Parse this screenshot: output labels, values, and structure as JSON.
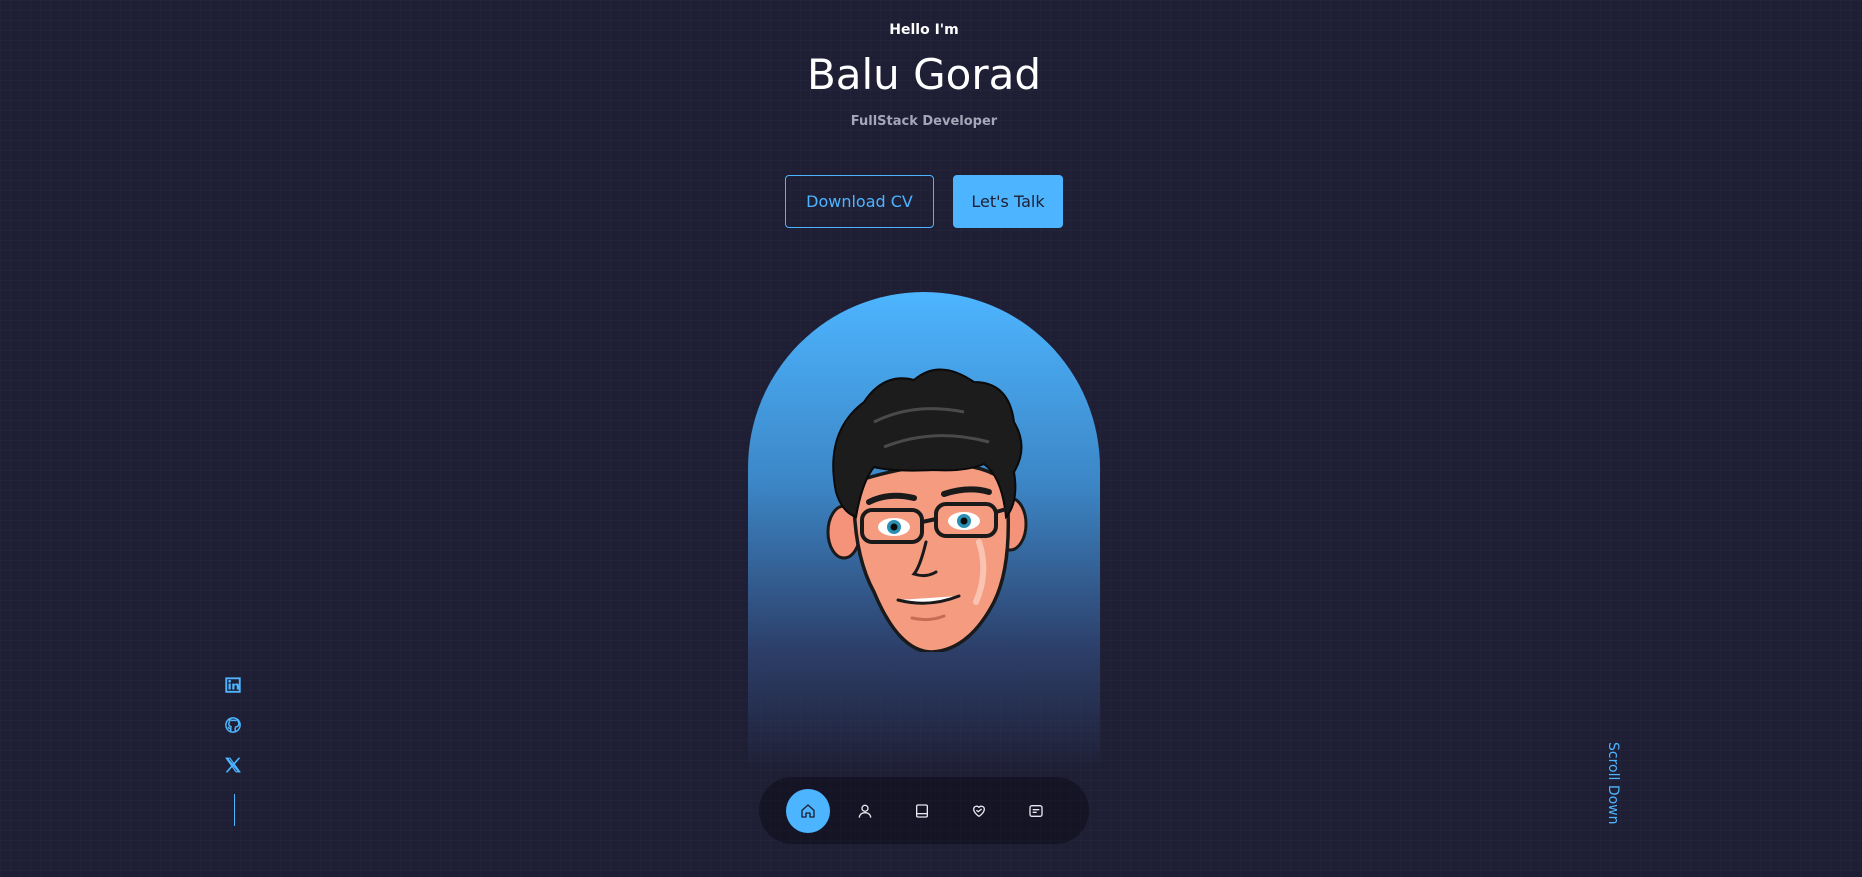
{
  "header": {
    "greeting": "Hello I'm",
    "name": "Balu Gorad",
    "role": "FullStack Developer"
  },
  "cta": {
    "download_cv_label": "Download CV",
    "lets_talk_label": "Let's Talk"
  },
  "avatar": {
    "icon": "cartoon-avatar"
  },
  "socials": [
    {
      "icon": "linkedin-icon"
    },
    {
      "icon": "github-icon"
    },
    {
      "icon": "x-twitter-icon"
    }
  ],
  "scroll_down_label": "Scroll Down",
  "nav": {
    "items": [
      {
        "icon": "home-icon",
        "active": true
      },
      {
        "icon": "user-icon",
        "active": false
      },
      {
        "icon": "book-icon",
        "active": false
      },
      {
        "icon": "services-icon",
        "active": false
      },
      {
        "icon": "message-icon",
        "active": false
      }
    ]
  },
  "colors": {
    "background": "#1e1e34",
    "accent": "#4db5ff",
    "text": "#ffffff",
    "muted_text": "#a5a7b8"
  }
}
